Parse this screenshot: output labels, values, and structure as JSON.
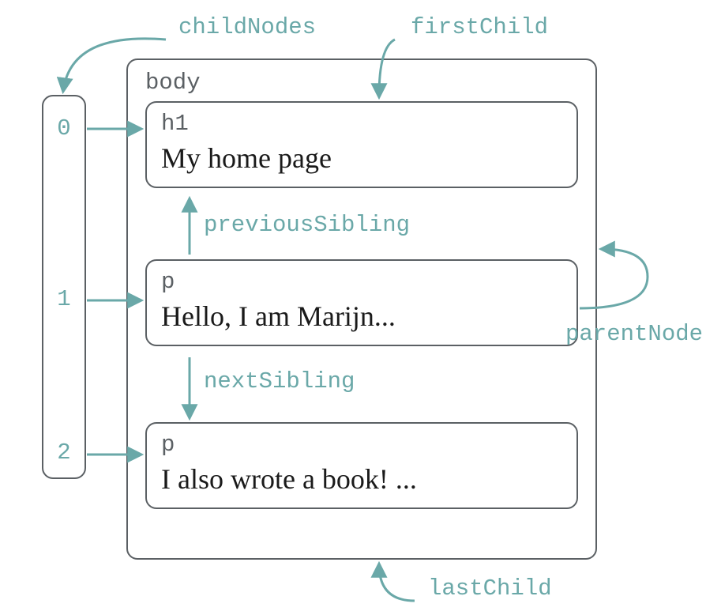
{
  "labels": {
    "childNodes": "childNodes",
    "firstChild": "firstChild",
    "previousSibling": "previousSibling",
    "parentNode": "parentNode",
    "nextSibling": "nextSibling",
    "lastChild": "lastChild"
  },
  "bodyTag": "body",
  "indices": [
    "0",
    "1",
    "2"
  ],
  "nodes": [
    {
      "tag": "h1",
      "text": "My home page"
    },
    {
      "tag": "p",
      "text": "Hello, I am Marijn..."
    },
    {
      "tag": "p",
      "text": "I also wrote a book! ..."
    }
  ]
}
